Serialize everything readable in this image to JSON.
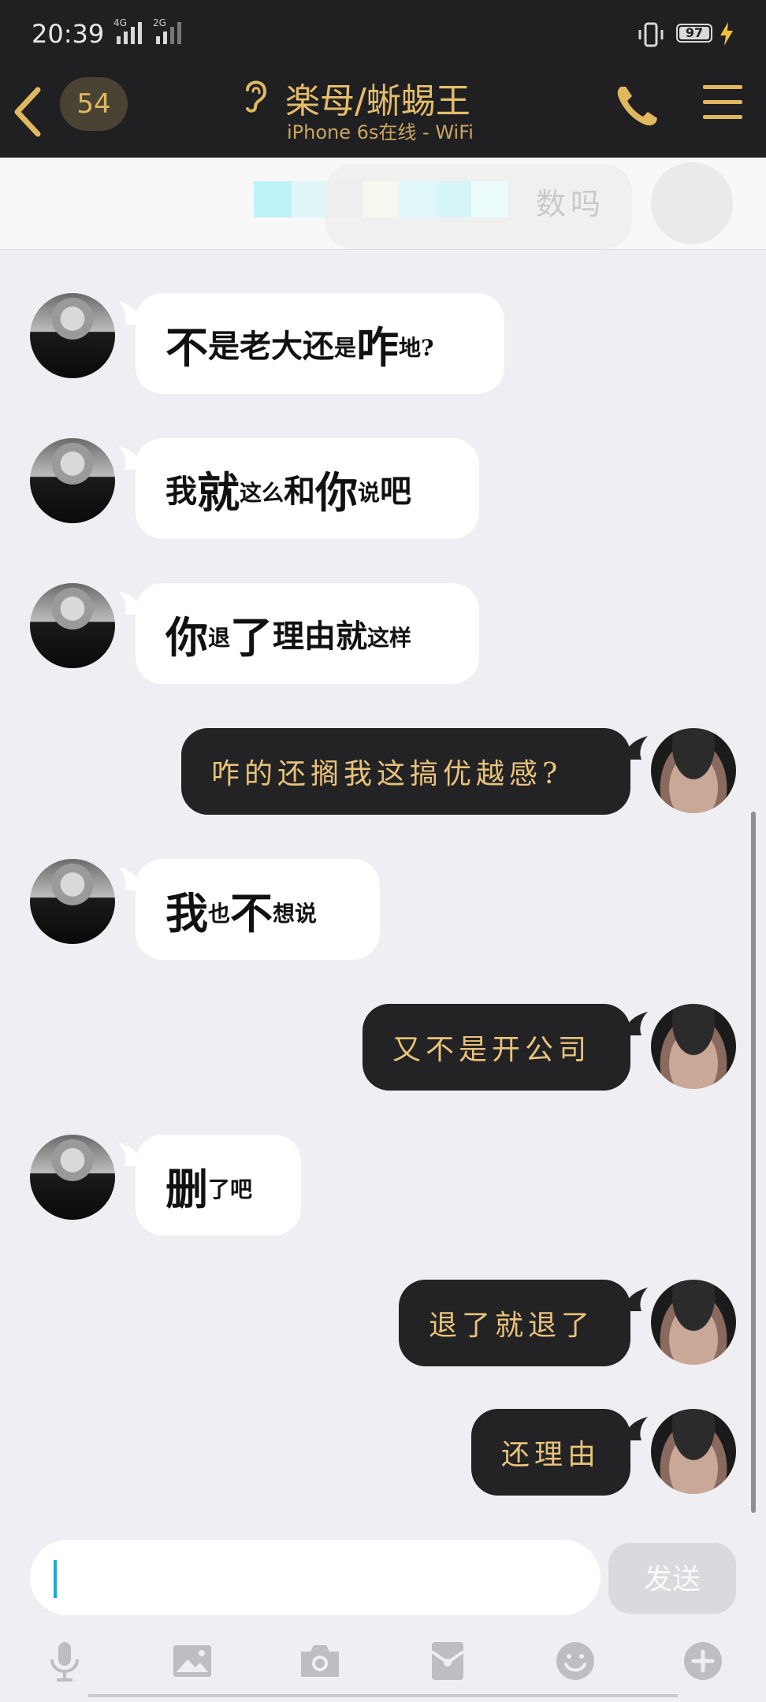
{
  "status_bar": {
    "time": "20:39",
    "network1": "4G",
    "network2": "2G",
    "battery": "97"
  },
  "header": {
    "back_count": "54",
    "title": "楽母/蜥蜴王",
    "subtitle": "iPhone 6s在线 - WiFi"
  },
  "pinned": {
    "text": "数吗"
  },
  "messages": [
    {
      "side": "in",
      "parts": [
        [
          "big",
          "不"
        ],
        [
          "mid",
          "是老大还"
        ],
        [
          "sm",
          "是"
        ],
        [
          "big",
          "咋"
        ],
        [
          "sm",
          "地?"
        ]
      ]
    },
    {
      "side": "in",
      "parts": [
        [
          "mid",
          "我"
        ],
        [
          "big",
          "就"
        ],
        [
          "sm",
          "这么"
        ],
        [
          "mid",
          "和"
        ],
        [
          "big",
          "你"
        ],
        [
          "sm",
          "说"
        ],
        [
          "mid",
          "吧"
        ]
      ]
    },
    {
      "side": "in",
      "parts": [
        [
          "big",
          "你"
        ],
        [
          "sm",
          "退"
        ],
        [
          "big",
          "了"
        ],
        [
          "mid",
          "理由就"
        ],
        [
          "sm",
          "这样"
        ]
      ]
    },
    {
      "side": "out",
      "text": "咋的还搁我这搞优越感?"
    },
    {
      "side": "in",
      "parts": [
        [
          "big",
          "我"
        ],
        [
          "sm",
          "也"
        ],
        [
          "big",
          "不"
        ],
        [
          "sm",
          "想说"
        ]
      ]
    },
    {
      "side": "out",
      "text": "又不是开公司"
    },
    {
      "side": "in",
      "parts": [
        [
          "big",
          "删"
        ],
        [
          "sm",
          "了吧"
        ]
      ]
    },
    {
      "side": "out",
      "text": "退了就退了"
    },
    {
      "side": "out",
      "text": "还理由"
    }
  ],
  "composer": {
    "send_label": "发送",
    "placeholder": ""
  },
  "toolbar": [
    "mic-icon",
    "image-icon",
    "camera-icon",
    "red-packet-icon",
    "emoji-icon",
    "plus-icon"
  ],
  "colors": {
    "accent": "#e4bd6a",
    "header_bg": "#202022",
    "chat_bg": "#eeeef3",
    "out_bubble": "#232325"
  }
}
